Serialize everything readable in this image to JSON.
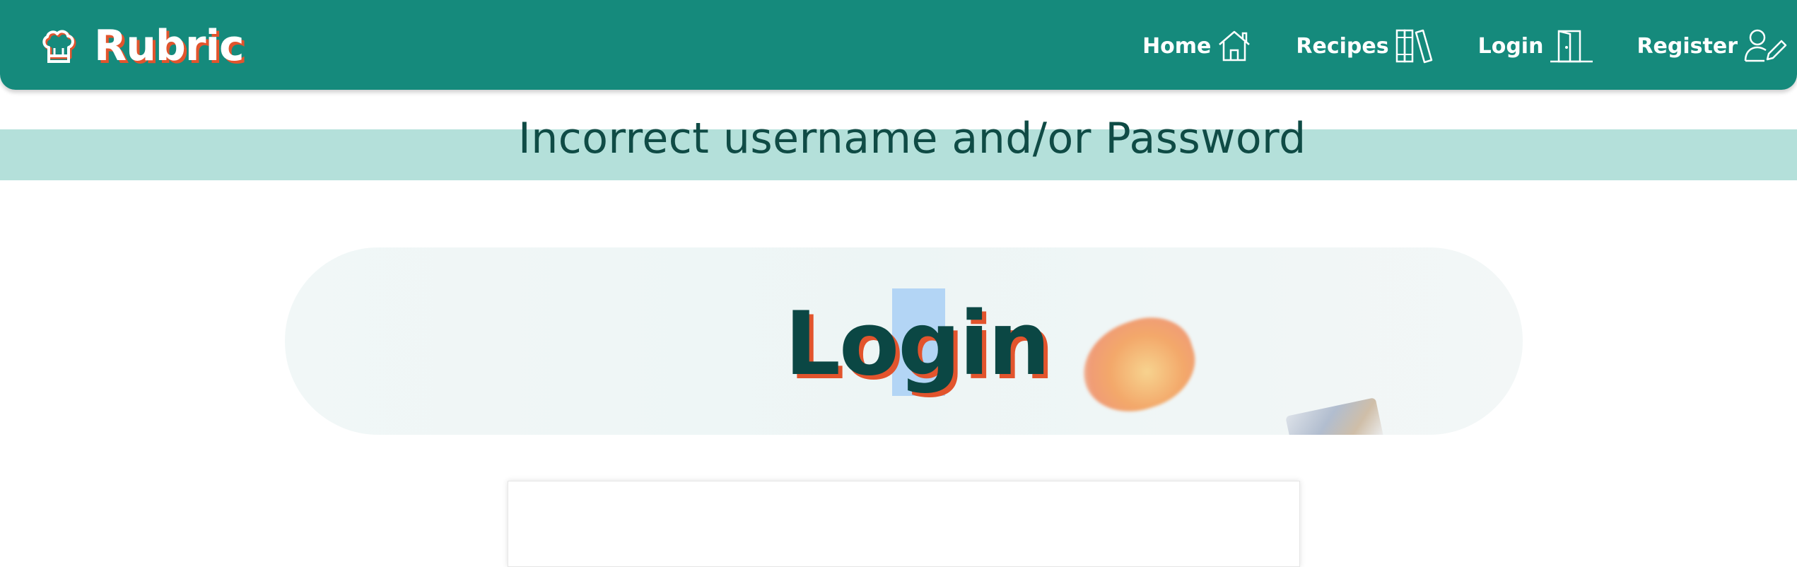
{
  "brand": {
    "name": "Rubric",
    "icon": "chef-hat-icon"
  },
  "nav": {
    "items": [
      {
        "label": "Home",
        "icon": "house-icon"
      },
      {
        "label": "Recipes",
        "icon": "books-icon"
      },
      {
        "label": "Login",
        "icon": "door-icon"
      },
      {
        "label": "Register",
        "icon": "user-pen-icon"
      }
    ]
  },
  "alert": {
    "message": "Incorrect username and/or Password"
  },
  "hero": {
    "title": "Login"
  },
  "colors": {
    "navbar": "#158a7c",
    "accent": "#e2542d",
    "alert_bg": "#b4e0da",
    "title_text": "#0b4744"
  }
}
